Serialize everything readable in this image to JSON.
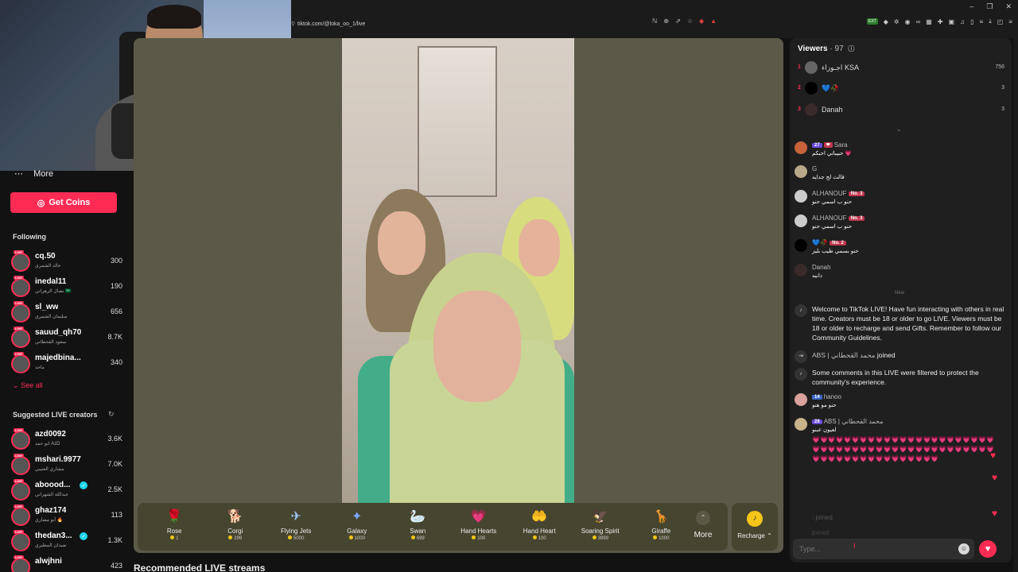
{
  "browser": {
    "url": "tiktok.com/@loka_oo_1/live",
    "lock_icon": "tune-icon",
    "extensions_label": "EXT"
  },
  "sidebar": {
    "more_label": "More",
    "get_coins_label": "Get Coins",
    "following_title": "Following",
    "following": [
      {
        "name": "cq.50",
        "sub": "خالد الشمري",
        "count": "300"
      },
      {
        "name": "inedal11",
        "sub": "نضال الزهراني 🇸🇦",
        "count": "190"
      },
      {
        "name": "sl_ww",
        "sub": "سليمان الشمري",
        "count": "656"
      },
      {
        "name": "sauud_qh70",
        "sub": "سعود القحطاني",
        "count": "8.7K"
      },
      {
        "name": "majedbina...",
        "sub": "ماجد",
        "count": "340"
      }
    ],
    "see_all_label": "See all",
    "suggested_title": "Suggested LIVE creators",
    "suggested": [
      {
        "name": "azd0092",
        "sub": "ابو حمد AzD",
        "count": "3.6K",
        "verified": false
      },
      {
        "name": "mshari.9977",
        "sub": "مشاري العتيبي",
        "count": "7.0K",
        "verified": false
      },
      {
        "name": "aboood...",
        "sub": "عبدالله الشهراني",
        "count": "2.5K",
        "verified": true
      },
      {
        "name": "ghaz174",
        "sub": "أبو مشاري 🔥",
        "count": "113",
        "verified": false
      },
      {
        "name": "thedan3...",
        "sub": "ضيدان المطيري",
        "count": "1.3K",
        "verified": true
      },
      {
        "name": "alwjhni",
        "sub": "",
        "count": "423",
        "verified": false
      }
    ]
  },
  "gifts": [
    {
      "name": "Rose",
      "price": "1",
      "icon": "🌹"
    },
    {
      "name": "Corgi",
      "price": "299",
      "icon": "🐕"
    },
    {
      "name": "Flying Jets",
      "price": "5000",
      "icon": "✈"
    },
    {
      "name": "Galaxy",
      "price": "1000",
      "icon": "✦"
    },
    {
      "name": "Swan",
      "price": "699",
      "icon": "🦢"
    },
    {
      "name": "Hand Hearts",
      "price": "100",
      "icon": "💗"
    },
    {
      "name": "Hand Heart",
      "price": "100",
      "icon": "🤲"
    },
    {
      "name": "Soaring Spirit",
      "price": "3999",
      "icon": "🦅"
    },
    {
      "name": "Giraffe",
      "price": "1000",
      "icon": "🦒"
    }
  ],
  "more_gifts_label": "More",
  "recharge_label": "Recharge",
  "recommended_label": "Recommended LIVE streams",
  "viewers": {
    "title": "Viewers",
    "count": "97",
    "top": [
      {
        "rank": "1",
        "name": "اجـوزاء KSA",
        "score": "756"
      },
      {
        "rank": "2",
        "name": "💙🥀",
        "score": "3"
      },
      {
        "rank": "3",
        "name": "Danah",
        "score": "3"
      }
    ]
  },
  "comments": [
    {
      "name": "Sara",
      "badges": [
        "27",
        "❤"
      ],
      "text": "حبيباتي احبكم 💗"
    },
    {
      "name": "G",
      "badges": [],
      "text": "قالت لج جدايه"
    },
    {
      "name": "ALHANOUF",
      "badges": [
        "No. 3"
      ],
      "text": "حنو ب اسمي حنو"
    },
    {
      "name": "ALHANOUF",
      "badges": [
        "No. 3"
      ],
      "text": "حنو ب اسمي حنو"
    },
    {
      "name": "💙🥀",
      "badges": [
        "No. 2"
      ],
      "text": "حنو بسمي طيب بليز"
    },
    {
      "name": "Danah",
      "badges": [],
      "text": "دانيه"
    }
  ],
  "new_divider": "New",
  "system_welcome": "Welcome to TikTok LIVE! Have fun interacting with others in real time. Creators must be 18 or older to go LIVE. Viewers must be 18 or older to recharge and send Gifts. Remember to follow our Community Guidelines.",
  "joined": {
    "name": "ABS | محمد القحطاني",
    "action": "joined"
  },
  "system_filtered": "Some comments in this LIVE were filtered to protect the community's experience.",
  "comment_hanoo": {
    "name": "hanoo",
    "badge": "14",
    "text": "حنو مو هنو"
  },
  "comment_abs": {
    "name": "ABS | محمد القحطاني",
    "badge": "28",
    "text": "لعيون عبنو",
    "hearts": "💗💗💗💗💗💗💗💗💗💗💗💗💗💗💗💗💗💗💗💗💗💗💗💗💗💗💗💗💗💗💗💗💗💗💗💗💗💗💗💗💗💗💗💗💗💗💗💗💗💗💗💗💗💗💗💗💗💗💗💗💗💗"
  },
  "faded": [
    ": joined",
    "joined"
  ],
  "input": {
    "placeholder": "Type..."
  }
}
